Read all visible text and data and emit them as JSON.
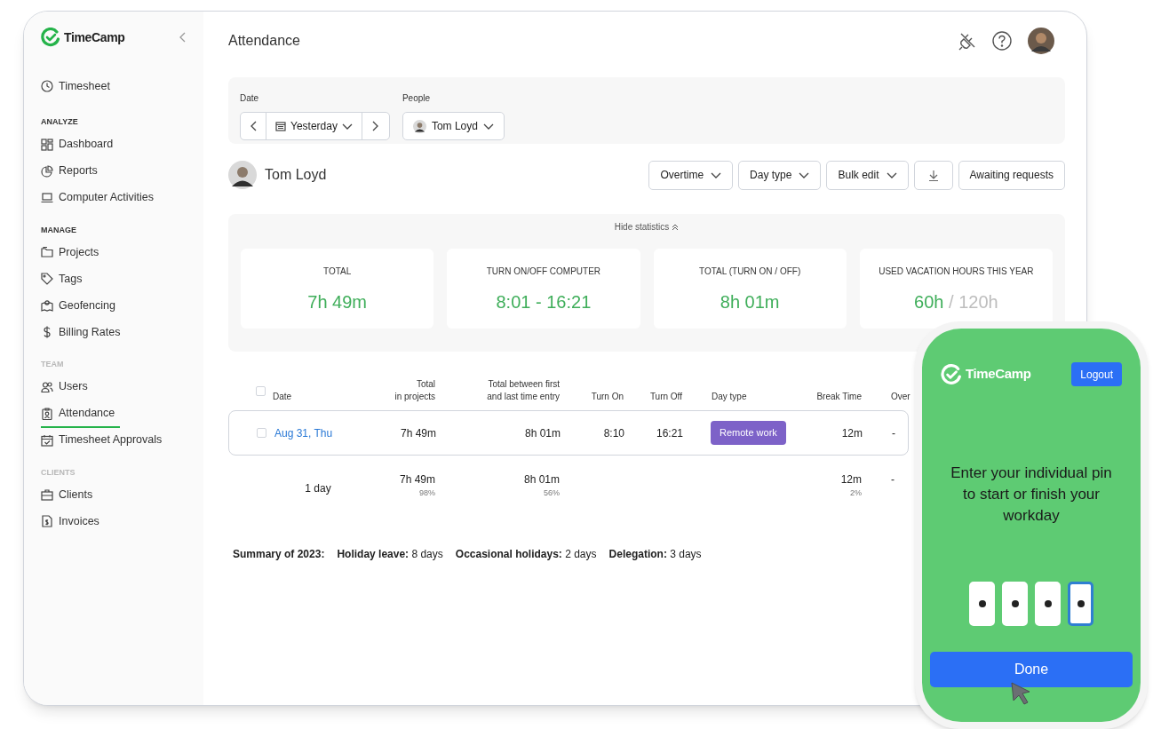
{
  "sidebar": {
    "logo": "TimeCamp",
    "groups": [
      {
        "items": [
          {
            "label": "Timesheet",
            "selected": false
          }
        ]
      },
      {
        "heading": "ANALYZE",
        "muted": false,
        "items": [
          {
            "label": "Dashboard",
            "selected": false
          },
          {
            "label": "Reports",
            "selected": false
          },
          {
            "label": "Computer Activities",
            "selected": false
          }
        ]
      },
      {
        "heading": "MANAGE",
        "muted": false,
        "items": [
          {
            "label": "Projects",
            "selected": false
          },
          {
            "label": "Tags",
            "selected": false
          },
          {
            "label": "Geofencing",
            "selected": false
          },
          {
            "label": "Billing Rates",
            "selected": false
          }
        ]
      },
      {
        "heading": "TEAM",
        "muted": true,
        "items": [
          {
            "label": "Users",
            "selected": false
          },
          {
            "label": "Attendance",
            "selected": true
          },
          {
            "label": "Timesheet Approvals",
            "selected": false
          }
        ]
      },
      {
        "heading": "CLIENTS",
        "muted": true,
        "items": [
          {
            "label": "Clients",
            "selected": false
          },
          {
            "label": "Invoices",
            "selected": false
          }
        ]
      }
    ]
  },
  "header": {
    "title": "Attendance"
  },
  "filters": [
    {
      "label": "Date",
      "kind": "stepper",
      "value": "Yesterday"
    },
    {
      "label": "People",
      "kind": "person",
      "value": "Tom Loyd"
    }
  ],
  "person": {
    "name": "Tom Loyd"
  },
  "actions": [
    {
      "kind": "dropdown",
      "label": "Overtime"
    },
    {
      "kind": "dropdown",
      "label": "Day type"
    },
    {
      "kind": "dropdown",
      "label": "Bulk edit"
    },
    {
      "kind": "download"
    },
    {
      "kind": "plain",
      "label": "Awaiting requests"
    }
  ],
  "statistics": {
    "toggle": "Hide statistics",
    "cards": [
      {
        "label": "TOTAL",
        "value": "7h 49m"
      },
      {
        "label": "TURN ON/OFF COMPUTER",
        "value": "8:01 - 16:21"
      },
      {
        "label": "TOTAL (TURN ON / OFF)",
        "value": "8h 01m"
      },
      {
        "label": "USED VACATION HOURS THIS YEAR",
        "value": "60h",
        "limit": "/ 120h"
      }
    ]
  },
  "table": {
    "header_checked": false,
    "columns": [
      [
        "Date"
      ],
      [
        "Total",
        "in projects"
      ],
      [
        "Total between first",
        "and last time entry"
      ],
      [
        "Turn On"
      ],
      [
        "Turn Off"
      ],
      [
        "Day type"
      ],
      [
        "Break Time"
      ],
      [
        "Over"
      ]
    ],
    "rows": [
      {
        "checked": false,
        "date": "Aug 31, Thu",
        "total": "7h 49m",
        "between": "8h 01m",
        "turn_on": "8:10",
        "turn_off": "16:21",
        "day_type": "Remote work",
        "break": "12m",
        "over": "-"
      }
    ],
    "totals": {
      "label": "1 day",
      "total": "7h 49m",
      "total_share": "98%",
      "between": "8h 01m",
      "between_share": "56%",
      "break": "12m",
      "break_share": "2%",
      "over": "-"
    }
  },
  "summary": {
    "title": "Summary of 2023:",
    "items": [
      "**Holiday leave:** 8 days",
      "**Occasional holidays:** 2 days",
      "**Delegation:** 3 days"
    ]
  },
  "phone": {
    "logo": "TimeCamp",
    "logout": "Logout",
    "prompt": "Enter your individual pin to start or finish your workday",
    "pin": [
      {
        "filled": true,
        "focused": false
      },
      {
        "filled": true,
        "focused": false
      },
      {
        "filled": true,
        "focused": false
      },
      {
        "filled": true,
        "focused": true
      }
    ],
    "done": "Done"
  }
}
